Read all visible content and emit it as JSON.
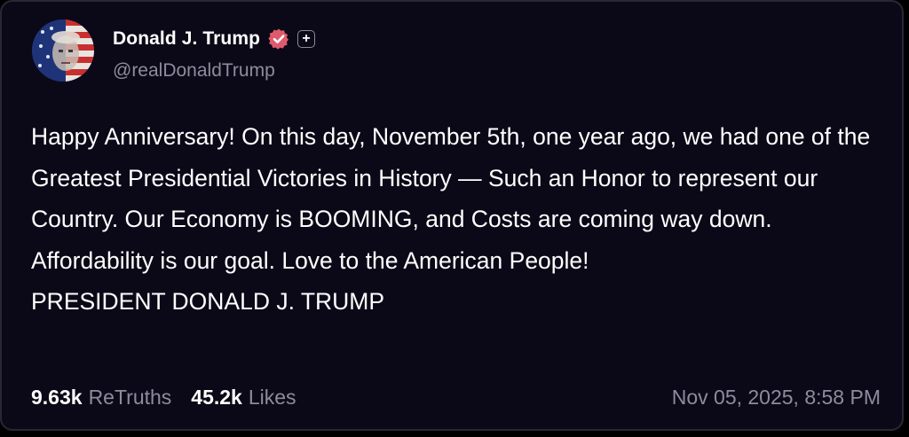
{
  "post": {
    "author": {
      "display_name": "Donald J. Trump",
      "handle": "@realDonaldTrump",
      "verified_icon": "verified-badge-icon",
      "plus_icon": "plus-icon"
    },
    "body_paragraphs": [
      "Happy Anniversary! On this day, November 5th, one year ago, we had one of the Greatest Presidential Victories in History — Such an Honor to represent our Country. Our Economy is BOOMING, and Costs are coming way down. Affordability is our goal. Love to the American People!",
      "PRESIDENT DONALD J. TRUMP"
    ],
    "stats": {
      "retruths_count": "9.63k",
      "retruths_label": "ReTruths",
      "likes_count": "45.2k",
      "likes_label": "Likes"
    },
    "timestamp": "Nov 05, 2025, 8:58 PM"
  },
  "colors": {
    "background": "#0b0917",
    "border": "#2a2735",
    "text_primary": "#ffffff",
    "text_secondary": "#8e8c9c",
    "verified_badge": "#e05a6e"
  }
}
